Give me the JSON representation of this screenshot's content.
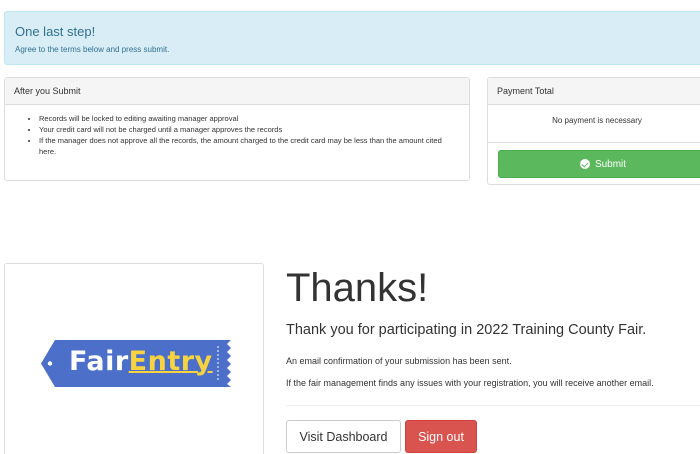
{
  "alert": {
    "title": "One last step!",
    "text": "Agree to the terms below and press submit."
  },
  "after_submit": {
    "heading": "After you Submit",
    "items": [
      "Records will be locked to editing awaiting manager approval",
      "Your credit card will not be charged until a manager approves the records",
      "If the manager does not approve all the records, the amount charged to the credit card may be less than the amount cited here."
    ]
  },
  "payment": {
    "heading": "Payment Total",
    "note": "No payment is necessary",
    "submit_label": "Submit"
  },
  "logo": {
    "part1": "Fair",
    "part2": "Entry",
    "colors": {
      "badge": "#4c6fc9",
      "text": "#ffffff",
      "accent": "#f6d33f"
    }
  },
  "thanks": {
    "title": "Thanks!",
    "lead": "Thank you for participating in 2022 Training County Fair.",
    "p1": "An email confirmation of your submission has been sent.",
    "p2": "If the fair management finds any issues with your registration, you will receive another email."
  },
  "actions": {
    "dashboard_label": "Visit Dashboard",
    "signout_label": "Sign out"
  }
}
